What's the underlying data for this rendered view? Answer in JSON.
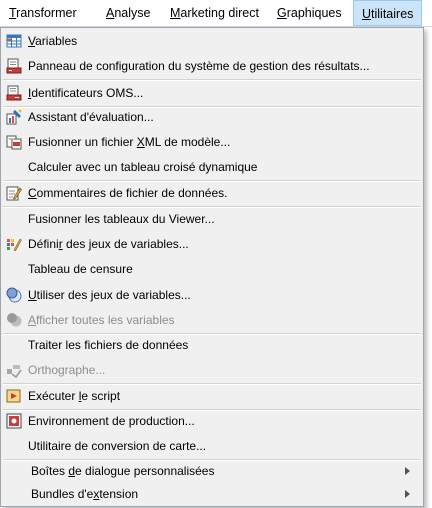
{
  "menubar": {
    "items": [
      {
        "pre": "",
        "u": "T",
        "post": "ransformer"
      },
      {
        "pre": "",
        "u": "A",
        "post": "nalyse"
      },
      {
        "pre": "",
        "u": "M",
        "post": "arketing direct"
      },
      {
        "pre": "",
        "u": "G",
        "post": "raphiques"
      },
      {
        "pre": "",
        "u": "U",
        "post": "tilitaires"
      }
    ]
  },
  "menu": {
    "items": [
      {
        "pre": "",
        "u": "V",
        "post": "ariables",
        "icon": "variables-grid-icon"
      },
      {
        "pre": "Panneau de configuration du système de gestion des résultats...",
        "u": "",
        "post": "",
        "icon": "control-panel-icon"
      },
      {
        "pre": "",
        "u": "I",
        "post": "dentificateurs OMS...",
        "icon": "oms-identifiers-icon"
      },
      {
        "pre": "Assistant d'évaluation...",
        "u": "",
        "post": "",
        "icon": "scoring-wizard-icon"
      },
      {
        "pre": "Fusionner un fichier ",
        "u": "X",
        "post": "ML de modèle...",
        "icon": "merge-xml-icon"
      },
      {
        "pre": "Calculer avec un tableau croisé dynamique",
        "u": "",
        "post": "",
        "icon": ""
      },
      {
        "pre": "",
        "u": "C",
        "post": "ommentaires de fichier de données.",
        "icon": "comments-edit-icon"
      },
      {
        "pre": "Fusionner les tableaux du Viewer...",
        "u": "",
        "post": "",
        "icon": ""
      },
      {
        "pre": "Défini",
        "u": "r",
        "post": " des jeux de variables...",
        "icon": "define-variable-sets-icon"
      },
      {
        "pre": "Tableau de censure",
        "u": "",
        "post": "",
        "icon": ""
      },
      {
        "pre": "",
        "u": "U",
        "post": "tiliser des jeux de variables...",
        "icon": "use-variable-sets-icon"
      },
      {
        "pre": "",
        "u": "A",
        "post": "fficher toutes les variables",
        "icon": "show-all-variables-icon",
        "disabled": true
      },
      {
        "pre": "Traiter les fichiers de données",
        "u": "",
        "post": "",
        "icon": ""
      },
      {
        "pre": "Orthographe...",
        "u": "",
        "post": "",
        "icon": "spelling-icon",
        "disabled": true
      },
      {
        "pre": "Exécuter ",
        "u": "l",
        "post": "e script",
        "icon": "run-script-icon"
      },
      {
        "pre": "Environnement de production...",
        "u": "",
        "post": "",
        "icon": "production-environment-icon"
      },
      {
        "pre": "Utilitaire de conversion de carte...",
        "u": "",
        "post": "",
        "icon": ""
      },
      {
        "pre": "Boîtes ",
        "u": "d",
        "post": "e dialogue personnalisées",
        "icon": "",
        "submenu": true
      },
      {
        "pre": "Bundles d'e",
        "u": "x",
        "post": "tension",
        "icon": "",
        "submenu": true
      }
    ]
  }
}
